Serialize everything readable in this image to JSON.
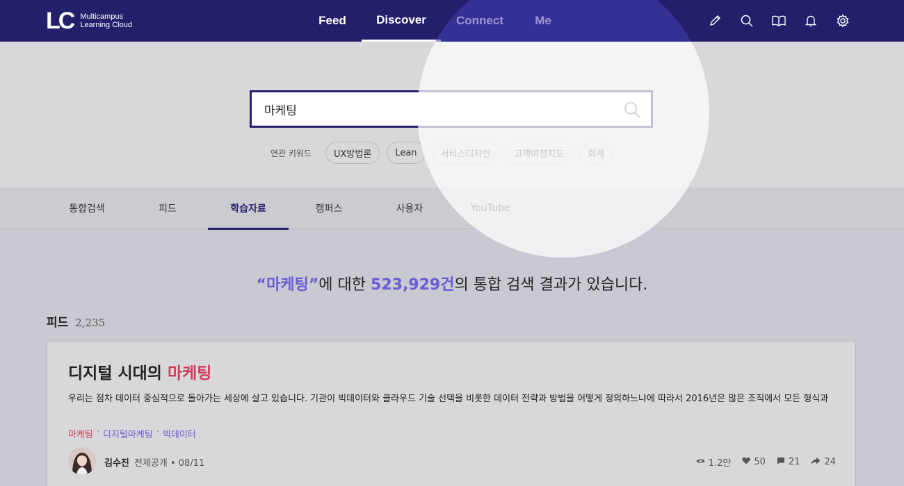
{
  "nav": {
    "logo_mark": "LC",
    "logo_line1": "Multicampus",
    "logo_line2": "Learning Cloud",
    "items": [
      {
        "label": "Feed"
      },
      {
        "label": "Discover"
      },
      {
        "label": "Connect"
      },
      {
        "label": "Me"
      }
    ],
    "icons": [
      "pencil-icon",
      "search-icon",
      "book-icon",
      "bell-icon",
      "gear-icon"
    ]
  },
  "search": {
    "value": "마케팅",
    "related_label": "연관 키워드",
    "keywords": [
      "UX방법론",
      "Lean",
      "서비스디자인",
      "고객여정지도",
      "회계"
    ]
  },
  "tabs": [
    "통합검색",
    "피드",
    "학습자료",
    "캠퍼스",
    "사용자",
    "YouTube"
  ],
  "active_tab": "학습자료",
  "result": {
    "query_quoted": "“마케팅”",
    "mid": "에 대한 ",
    "count": "523,929건",
    "suffix": "의 통합 검색 결과가 있습니다."
  },
  "feed": {
    "title": "피드",
    "count": "2,235",
    "card": {
      "title_prefix": "디지털 시대의 ",
      "title_highlight": "마케팅",
      "body": "우리는 점차 데이터 중심적으로 돌아가는 세상에 살고 있습니다. 기관이 빅데이터와 클라우드 기술 선택을 비롯한 데이터 전략과 방법을 어떻게 정의하느냐에 따라서 2016년은 많은 조직에서 모든 형식과",
      "tags": [
        "마케팅",
        "디지털마케팅",
        "빅데이터"
      ],
      "author": "김수진",
      "visibility": "전체공개",
      "date": "08/11",
      "views": "1.2만",
      "likes": "50",
      "comments": "21",
      "shares": "24"
    }
  },
  "colors": {
    "nav_bg": "#231f6b",
    "accent_purple": "#6b5bd6",
    "accent_red": "#d3385a"
  }
}
